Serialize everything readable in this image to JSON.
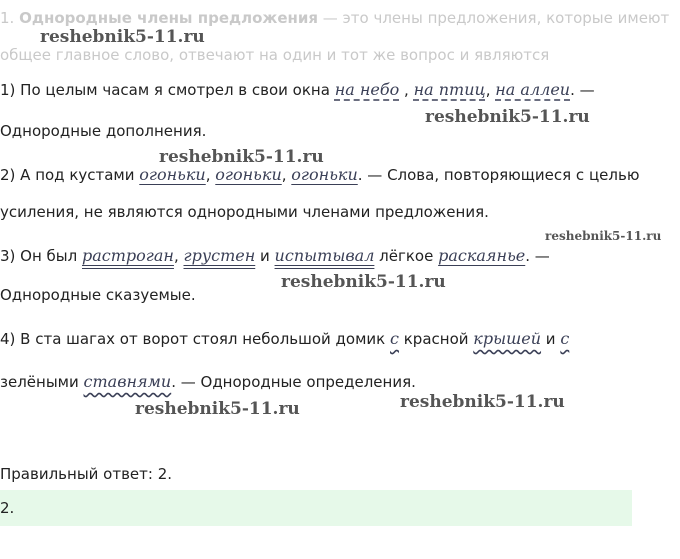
{
  "intro": {
    "number": "1.",
    "term": "Однородные члены предложения",
    "def_rest": " — это члены предложения, которые имеют",
    "line2": "общее главное слово, отвечают на один и тот же вопрос и являются"
  },
  "watermark": "reshebnik5-11.ru",
  "s1": {
    "before": "1) По целым часам я смотрел в свои окна ",
    "w1": "на небо",
    "sep1": " , ",
    "w2": "на птиц",
    "sep2": ", ",
    "w3": "на аллеи",
    "after": ". —",
    "line2": "Однородные дополнения."
  },
  "s2": {
    "before": "2) А под кустами ",
    "w1": "огоньки",
    "sep1": ", ",
    "w2": "огоньки",
    "sep2": ", ",
    "w3": "огоньки",
    "after": ". — Слова, повторяющиеся с целью",
    "line2": "усиления, не являются однородными членами предложения."
  },
  "s3": {
    "before": "3) Он был ",
    "w1": "растроган",
    "sep1": ", ",
    "w2": "грустен",
    "sep2": " и ",
    "w3": "испытывал",
    "mid": " лёгкое ",
    "w4": "раскаянье",
    "after": ". —",
    "line2": "Однородные сказуемые."
  },
  "s4": {
    "before": "4) В ста шагах от ворот стоял небольшой домик ",
    "w1": "с",
    "mid1": " красной ",
    "w2": "крышей",
    "mid2": " и ",
    "w3": "с",
    "line2_before": "зелёными ",
    "w4": "ставнями",
    "line2_after": ". — Однородные определения."
  },
  "answer": {
    "label": "Правильный ответ: 2.",
    "value": "2."
  }
}
